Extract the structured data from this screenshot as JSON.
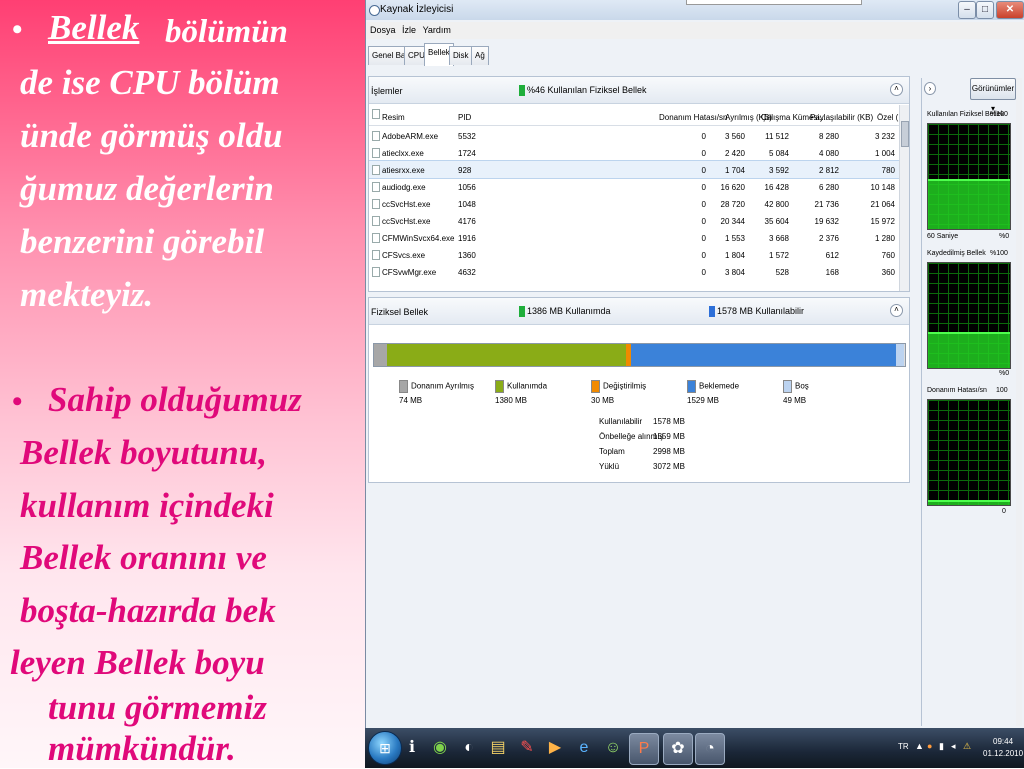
{
  "slide": {
    "bullet": "•",
    "p1_word": "Bellek",
    "p1_line1_rest": " bölümün",
    "p1_line2": "de ise CPU bölüm",
    "p1_line3": "ünde görmüş oldu",
    "p1_line4": "ğumuz değerlerin",
    "p1_line5": "benzerini görebil",
    "p1_line6": "mekteyiz.",
    "p2_line1": "Sahip olduğumuz",
    "p2_line2": "Bellek boyutunu,",
    "p2_line3": "kullanım içindeki",
    "p2_line4": "Bellek oranını ve",
    "p2_line5": "boşta-hazırda bek",
    "p2_line6": "leyen Bellek boyu",
    "p2_line7": "tunu görmemiz",
    "p2_line8": "mümkündür."
  },
  "window": {
    "title": "Kaynak İzleyicisi",
    "menu": [
      "Dosya",
      "İzle",
      "Yardım"
    ],
    "tabs": [
      "Genel Bakış",
      "CPU",
      "Bellek",
      "Disk",
      "Ağ"
    ],
    "active_tab": "Bellek"
  },
  "processes": {
    "title": "İşlemler",
    "status": "%46 Kullanılan Fiziksel Bellek",
    "status_color": "#1fae3b",
    "columns": [
      "Resim",
      "PID",
      "Donanım Hatası/sn",
      "Ayrılmış (KB)",
      "Çalışma Kümesi...",
      "Paylaşılabilir (KB)",
      "Özel (KB)"
    ],
    "rows": [
      {
        "name": "AdobeARM.exe",
        "pid": "5532",
        "hf": "0",
        "commit": "3 560",
        "ws": "11 512",
        "share": "8 280",
        "priv": "3 232"
      },
      {
        "name": "atieclxx.exe",
        "pid": "1724",
        "hf": "0",
        "commit": "2 420",
        "ws": "5 084",
        "share": "4 080",
        "priv": "1 004"
      },
      {
        "name": "atiesrxx.exe",
        "pid": "928",
        "hf": "0",
        "commit": "1 704",
        "ws": "3 592",
        "share": "2 812",
        "priv": "780"
      },
      {
        "name": "audiodg.exe",
        "pid": "1056",
        "hf": "0",
        "commit": "16 620",
        "ws": "16 428",
        "share": "6 280",
        "priv": "10 148"
      },
      {
        "name": "ccSvcHst.exe",
        "pid": "1048",
        "hf": "0",
        "commit": "28 720",
        "ws": "42 800",
        "share": "21 736",
        "priv": "21 064"
      },
      {
        "name": "ccSvcHst.exe",
        "pid": "4176",
        "hf": "0",
        "commit": "20 344",
        "ws": "35 604",
        "share": "19 632",
        "priv": "15 972"
      },
      {
        "name": "CFMWinSvcx64.exe",
        "pid": "1916",
        "hf": "0",
        "commit": "1 553",
        "ws": "3 668",
        "share": "2 376",
        "priv": "1 280"
      },
      {
        "name": "CFSvcs.exe",
        "pid": "1360",
        "hf": "0",
        "commit": "1 804",
        "ws": "1 572",
        "share": "612",
        "priv": "760"
      },
      {
        "name": "CFSvwMgr.exe",
        "pid": "4632",
        "hf": "0",
        "commit": "3 804",
        "ws": "528",
        "share": "168",
        "priv": "360"
      }
    ]
  },
  "physical": {
    "title": "Fiziksel Bellek",
    "used_label": "1386 MB Kullanımda",
    "used_color": "#1fae3b",
    "avail_label": "1578 MB Kullanılabilir",
    "avail_color": "#2d6fd8",
    "segments": [
      {
        "name": "Donanım Ayrılmış",
        "value": "74 MB",
        "mb": 74,
        "color": "#a7a7a7"
      },
      {
        "name": "Kullanımda",
        "value": "1380 MB",
        "mb": 1380,
        "color": "#8aac17"
      },
      {
        "name": "Değiştirilmiş",
        "value": "30 MB",
        "mb": 30,
        "color": "#f18a00"
      },
      {
        "name": "Beklemede",
        "value": "1529 MB",
        "mb": 1529,
        "color": "#3b82d9"
      },
      {
        "name": "Boş",
        "value": "49 MB",
        "mb": 49,
        "color": "#bcd3f0"
      }
    ],
    "totals": [
      {
        "label": "Kullanılabilir",
        "value": "1578 MB"
      },
      {
        "label": "Önbelleğe alınmış",
        "value": "1559 MB"
      },
      {
        "label": "Toplam",
        "value": "2998 MB"
      },
      {
        "label": "Yüklü",
        "value": "3072 MB"
      }
    ]
  },
  "side": {
    "views_label": "Görünümler",
    "graphs": [
      {
        "title": "Kullanılan Fiziksel Bellek",
        "max": "%100",
        "min_left": "60 Saniye",
        "min_right": "%0",
        "level": 0.46
      },
      {
        "title": "Kaydedilmiş Bellek",
        "max": "%100",
        "min_left": "",
        "min_right": "%0",
        "level": 0.32
      },
      {
        "title": "Donanım Hatası/sn",
        "max": "100",
        "min_left": "",
        "min_right": "0",
        "level": 0.03
      }
    ]
  },
  "taskbar": {
    "lang": "TR",
    "time": "09:44",
    "date": "01.12.2010",
    "apps": [
      "windows-explorer",
      "info",
      "chrome",
      "media",
      "notes",
      "paint",
      "media-player",
      "internet-explorer",
      "messenger",
      "powerpoint",
      "picasa",
      "resource-monitor"
    ]
  }
}
